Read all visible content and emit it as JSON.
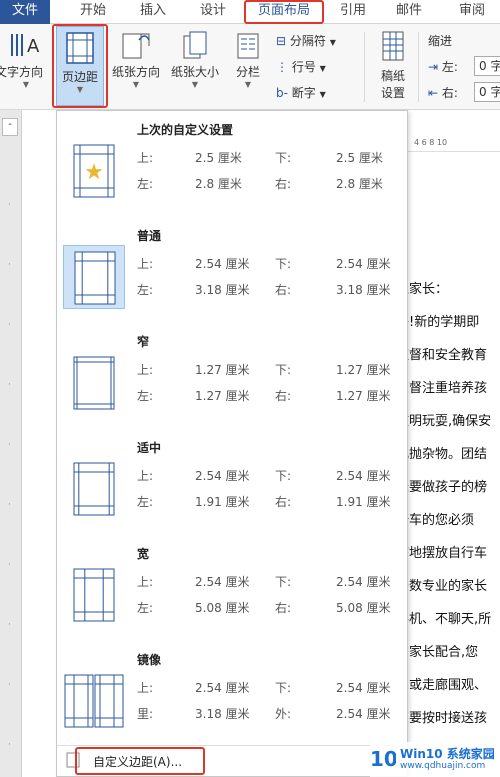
{
  "tabs": [
    "文件",
    "开始",
    "插入",
    "设计",
    "页面布局",
    "引用",
    "邮件",
    "审阅"
  ],
  "active_tab": "页面布局",
  "ribbon": {
    "text_direction": "文字方向",
    "margins": "页边距",
    "orientation": "纸张方向",
    "size": "纸张大小",
    "columns": "分栏",
    "breaks": "分隔符",
    "line_numbers": "行号",
    "hyphenation": "断字",
    "manuscript_line1": "稿纸",
    "manuscript_line2": "设置",
    "indent_title": "缩进",
    "indent_left_label": "左:",
    "indent_left_value": "0 字",
    "indent_right_label": "右:",
    "indent_right_value": "0 字"
  },
  "ruler_marks": "4  6  8  10",
  "margin_options": [
    {
      "title": "上次的自定义设置",
      "r1": [
        "上:",
        "2.5 厘米",
        "下:",
        "2.5 厘米"
      ],
      "r2": [
        "左:",
        "2.8 厘米",
        "右:",
        "2.8 厘米"
      ],
      "icon": "star-page-icon"
    },
    {
      "title": "普通",
      "r1": [
        "上:",
        "2.54 厘米",
        "下:",
        "2.54 厘米"
      ],
      "r2": [
        "左:",
        "3.18 厘米",
        "右:",
        "3.18 厘米"
      ],
      "icon": "normal-margin-icon"
    },
    {
      "title": "窄",
      "r1": [
        "上:",
        "1.27 厘米",
        "下:",
        "1.27 厘米"
      ],
      "r2": [
        "左:",
        "1.27 厘米",
        "右:",
        "1.27 厘米"
      ],
      "icon": "narrow-margin-icon"
    },
    {
      "title": "适中",
      "r1": [
        "上:",
        "2.54 厘米",
        "下:",
        "2.54 厘米"
      ],
      "r2": [
        "左:",
        "1.91 厘米",
        "右:",
        "1.91 厘米"
      ],
      "icon": "moderate-margin-icon"
    },
    {
      "title": "宽",
      "r1": [
        "上:",
        "2.54 厘米",
        "下:",
        "2.54 厘米"
      ],
      "r2": [
        "左:",
        "5.08 厘米",
        "右:",
        "5.08 厘米"
      ],
      "icon": "wide-margin-icon"
    },
    {
      "title": "镜像",
      "r1": [
        "上:",
        "2.54 厘米",
        "下:",
        "2.54 厘米"
      ],
      "r2": [
        "里:",
        "3.18 厘米",
        "外:",
        "2.54 厘米"
      ],
      "icon": "mirrored-margin-icon"
    }
  ],
  "custom_margins": "自定义边距(A)...",
  "doc_lines": [
    "位家长：",
    "子!新的学期即",
    "监督和安全教育",
    "您督注重培养孩",
    "文明玩耍,确保安",
    "乱抛杂物。团结",
    "长要做孩子的榜",
    "骑车的您必须",
    "序地摆放自行车",
    "少数专业的家长",
    "手机、不聊天,所",
    "需家长配合,您",
    "口或走廊围观、",
    "您要按时接送孩"
  ],
  "watermark": {
    "brand": "Win10 系统家园",
    "url": "www.qdhuajin.com"
  },
  "colors": {
    "accent": "#2b579a",
    "highlight": "#e0352b",
    "selected": "#cfe3f8"
  }
}
